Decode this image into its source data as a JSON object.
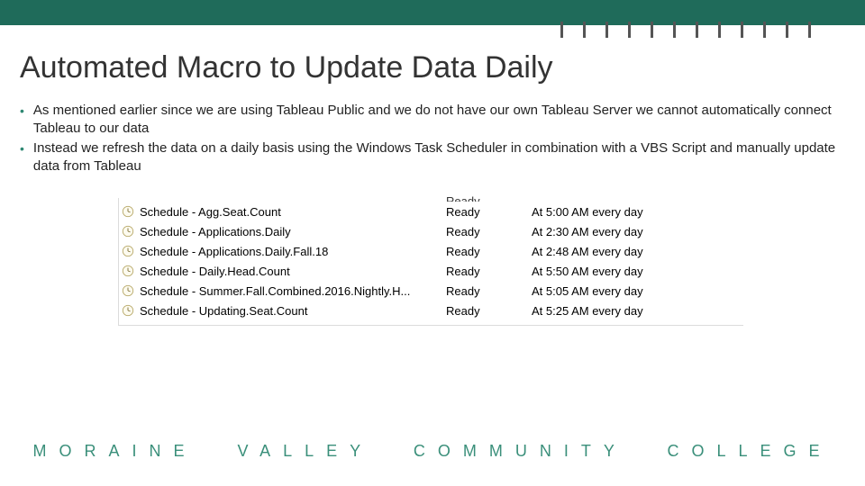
{
  "title": "Automated Macro to Update Data Daily",
  "bullets": [
    "As mentioned earlier since we are using Tableau Public and we do not have our own Tableau Server we cannot automatically connect Tableau to our data",
    "Instead we refresh the data on a daily basis using the Windows Task Scheduler in combination with a VBS Script and manually update data from Tableau"
  ],
  "task_rows": [
    {
      "name": "Schedule - Agg.Seat.Count",
      "status": "Ready",
      "trigger": "At 5:00 AM every day"
    },
    {
      "name": "Schedule - Applications.Daily",
      "status": "Ready",
      "trigger": "At 2:30 AM every day"
    },
    {
      "name": "Schedule - Applications.Daily.Fall.18",
      "status": "Ready",
      "trigger": "At 2:48 AM every day"
    },
    {
      "name": "Schedule - Daily.Head.Count",
      "status": "Ready",
      "trigger": "At 5:50 AM every day"
    },
    {
      "name": "Schedule - Summer.Fall.Combined.2016.Nightly.H...",
      "status": "Ready",
      "trigger": "At 5:05 AM every day"
    },
    {
      "name": "Schedule - Updating.Seat.Count",
      "status": "Ready",
      "trigger": "At 5:25 AM every day"
    }
  ],
  "cut_row": {
    "status": "Ready"
  },
  "footer": "MORAINE VALLEY COMMUNITY COLLEGE"
}
